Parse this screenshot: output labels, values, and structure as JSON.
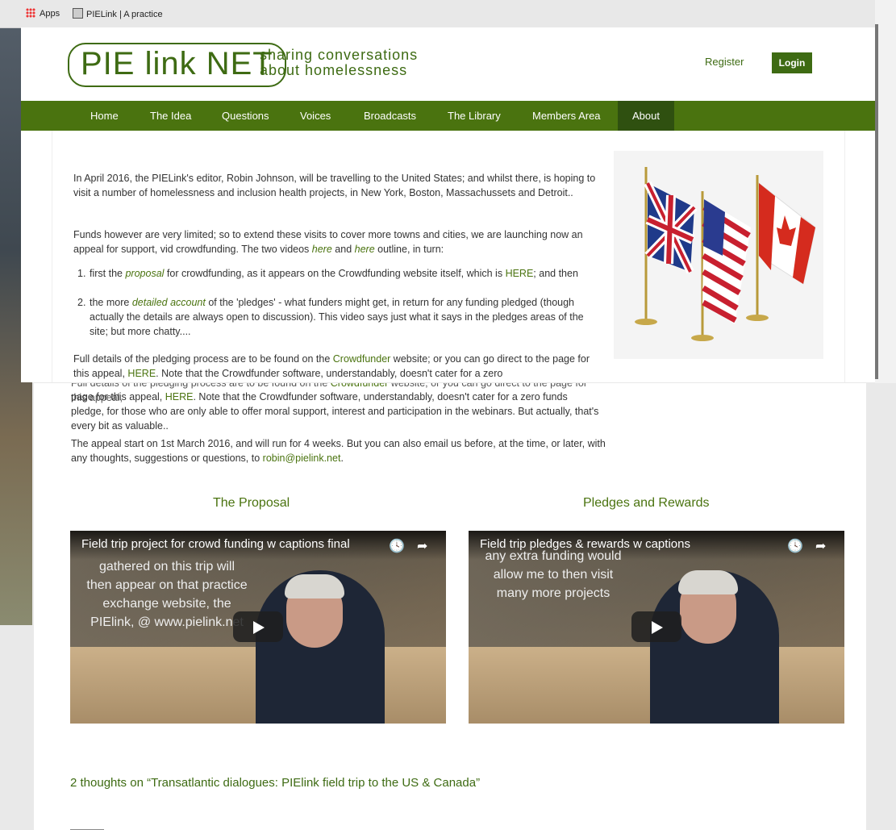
{
  "bookmarks": {
    "apps_label": "Apps",
    "item_label": "PIELink | A practice"
  },
  "site": {
    "logo_text": "PIE link NET",
    "tagline_line1": "sharing conversations",
    "tagline_line2": "about homelessness",
    "register_label": "Register",
    "login_label": "Login"
  },
  "nav": [
    "Home",
    "The Idea",
    "Questions",
    "Voices",
    "Broadcasts",
    "The Library",
    "Members Area",
    "About"
  ],
  "article": {
    "p1": "In April 2016, the PIELink's editor, Robin Johnson, will be travelling to the United States; and whilst there, is hoping to visit a number of homelessness and inclusion health projects, in New York, Boston, Massachussets and Detroit..",
    "p2_a": "Funds however are very limited; so to extend these visits to cover more towns and cities, we are launching now an appeal for support, vid crowdfunding. The two videos ",
    "p2_here1": "here",
    "p2_and": " and ",
    "p2_here2": "here",
    "p2_b": " outline, in turn:",
    "li1_a": "first the ",
    "li1_link": "proposal",
    "li1_b": " for crowdfunding, as it appears on the Crowdfunding website itself, which is ",
    "li1_here": "HERE",
    "li1_c": "; and then",
    "li2_a": "the more ",
    "li2_link": "detailed account",
    "li2_b": " of the 'pledges' - what funders might get, in return for any funding pledged (though actually the details are always open to discussion).  This video says just what it says in the pledges areas of the site; but more chatty....",
    "p3_a": "Full details of the pledging process are to be found on the ",
    "p3_crowdfunder": "Crowdfunder",
    "p3_b": " website; or you can go direct to the page for this appeal, ",
    "p3_here": "HERE",
    "p3_c": ". Note that the Crowdfunder software, understandably, doesn't cater for a zero",
    "p3_cont_a": "page for this appeal, ",
    "p3_cont_here": "HERE",
    "p3_cont_b": ". Note that the Crowdfunder software, understandably, doesn't cater for a zero funds pledge, for those who are only able to offer moral support, interest and participation in the webinars. But actually, that's every bit as valuable..",
    "p4_a": "The appeal start on 1st March 2016, and will run for 4 weeks.  But you can also email us before, at the time, or later, with any thoughts, suggestions or questions, to ",
    "p4_email": "robin@pielink.net",
    "p4_b": "."
  },
  "videos": [
    {
      "heading": "The Proposal",
      "title": "Field trip project for crowd funding w captions final",
      "caption": "gathered on this trip will then appear on that practice exchange website, the PIElink, @ www.pielink.net"
    },
    {
      "heading": "Pledges and Rewards",
      "title": "Field trip pledges & rewards w captions",
      "caption": "any extra funding would allow me to then visit many more projects"
    }
  ],
  "comments_heading": "2 thoughts on “Transatlantic dialogues: PIElink field trip to the US & Canada”",
  "colors": {
    "brand_green": "#4a730f",
    "nav_active": "#2f5010"
  },
  "icons": [
    "apps-grid-icon",
    "clock-icon",
    "share-icon",
    "play-icon"
  ]
}
